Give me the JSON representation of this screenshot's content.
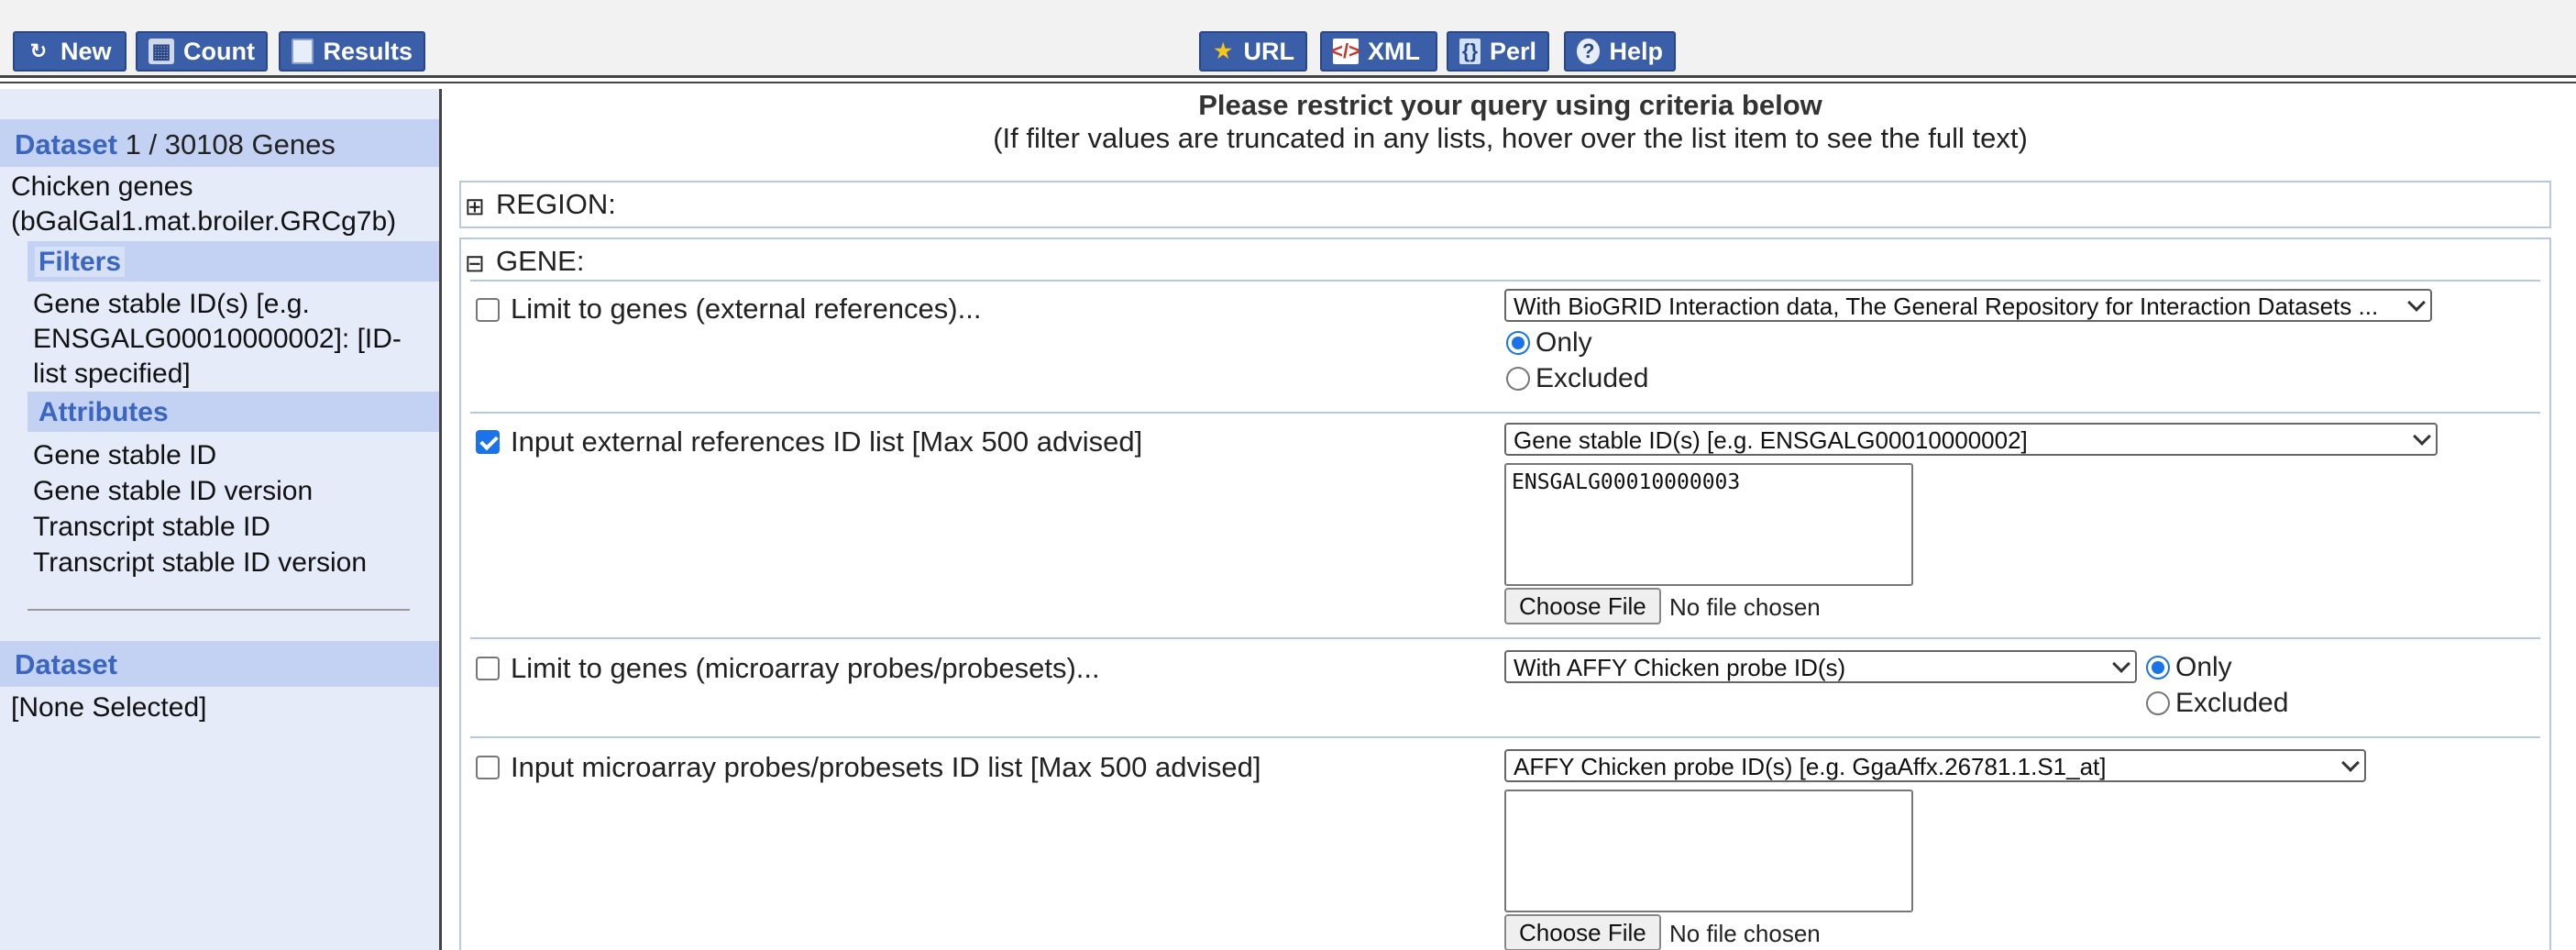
{
  "toolbar": {
    "new_label": "New",
    "count_label": "Count",
    "results_label": "Results",
    "url_label": "URL",
    "xml_label": "XML",
    "perl_label": "Perl",
    "help_label": "Help"
  },
  "sidebar": {
    "dataset_header_prefix": "Dataset",
    "dataset_count": "1 / 30108 Genes",
    "dataset_name_line1": "Chicken genes",
    "dataset_name_line2": "(bGalGal1.mat.broiler.GRCg7b)",
    "filters_title": "Filters",
    "filter_items": [
      "Gene stable ID(s) [e.g.",
      "ENSGALG00010000002]: [ID-",
      "list specified]"
    ],
    "attributes_title": "Attributes",
    "attribute_items": [
      "Gene stable ID",
      "Gene stable ID version",
      "Transcript stable ID",
      "Transcript stable ID version"
    ],
    "dataset2_title": "Dataset",
    "dataset2_value": "[None Selected]"
  },
  "main": {
    "title": "Please restrict your query using criteria below",
    "subtitle": "(If filter values are truncated in any lists, hover over the list item to see the full text)",
    "region_label": "REGION:",
    "gene_label": "GENE:",
    "rows": [
      {
        "label": "Limit to genes (external references)...",
        "checked": false,
        "select": "With BioGRID Interaction data, The General Repository for Interaction Datasets ...",
        "radio_only": "Only",
        "radio_excluded": "Excluded"
      },
      {
        "label": "Input external references ID list [Max 500 advised]",
        "checked": true,
        "select": "Gene stable ID(s) [e.g. ENSGALG00010000002]",
        "textarea": "ENSGALG00010000003",
        "file_button": "Choose File",
        "file_status": "No file chosen"
      },
      {
        "label": "Limit to genes (microarray probes/probesets)...",
        "checked": false,
        "select": "With AFFY Chicken probe ID(s)",
        "radio_only": "Only",
        "radio_excluded": "Excluded"
      },
      {
        "label": "Input microarray probes/probesets ID list [Max 500 advised]",
        "checked": false,
        "select": "AFFY Chicken probe ID(s) [e.g. GgaAffx.26781.1.S1_at]",
        "textarea": "",
        "file_button": "Choose File",
        "file_status": "No file chosen"
      }
    ]
  },
  "colors": {
    "toolbar_button": "#3a5fa8",
    "sidebar_bg": "#e6ebfa",
    "sidebar_header": "#c3d2f3",
    "accent_text": "#3a66c0",
    "panel_border": "#b7c7ea"
  }
}
